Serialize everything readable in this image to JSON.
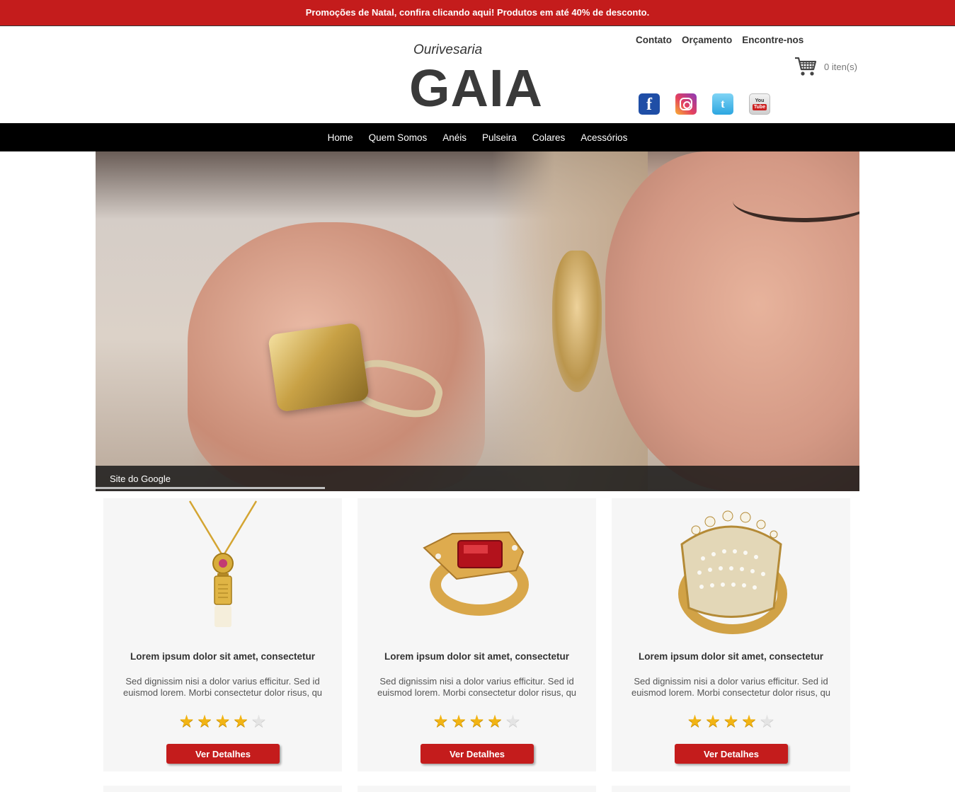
{
  "promo": {
    "text": "Promoções de Natal, confira clicando aqui! Produtos em até 40% de desconto."
  },
  "brand": {
    "subtitle": "Ourivesaria",
    "name": "GAIA"
  },
  "top_links": [
    "Contato",
    "Orçamento",
    "Encontre-nos"
  ],
  "cart": {
    "count_label": "0 iten(s)"
  },
  "socials": {
    "facebook": "f",
    "twitter": "t",
    "youtube_you": "You",
    "youtube_tube": "Tube"
  },
  "nav": [
    "Home",
    "Quem Somos",
    "Anéis",
    "Pulseira",
    "Colares",
    "Acessórios"
  ],
  "hero": {
    "caption": "Site do Google",
    "progress": 0.3
  },
  "products": [
    {
      "title": "Lorem ipsum dolor sit amet, consectetur",
      "description": "Sed dignissim nisi a dolor varius efficitur. Sed id euismod lorem. Morbi consectetur dolor risus, qu",
      "rating": 4,
      "max_rating": 5,
      "button": "Ver Detalhes",
      "image": "necklace-pendant-icon"
    },
    {
      "title": "Lorem ipsum dolor sit amet, consectetur",
      "description": "Sed dignissim nisi a dolor varius efficitur. Sed id euismod lorem. Morbi consectetur dolor risus, qu",
      "rating": 4,
      "max_rating": 5,
      "button": "Ver Detalhes",
      "image": "ruby-ring-icon"
    },
    {
      "title": "Lorem ipsum dolor sit amet, consectetur",
      "description": "Sed dignissim nisi a dolor varius efficitur. Sed id euismod lorem. Morbi consectetur dolor risus, qu",
      "rating": 4,
      "max_rating": 5,
      "button": "Ver Detalhes",
      "image": "diamond-ring-icon"
    }
  ],
  "colors": {
    "accent": "#c41c1c",
    "nav_bg": "#000000",
    "card_bg": "#f6f6f6",
    "star": "#f2b414"
  }
}
